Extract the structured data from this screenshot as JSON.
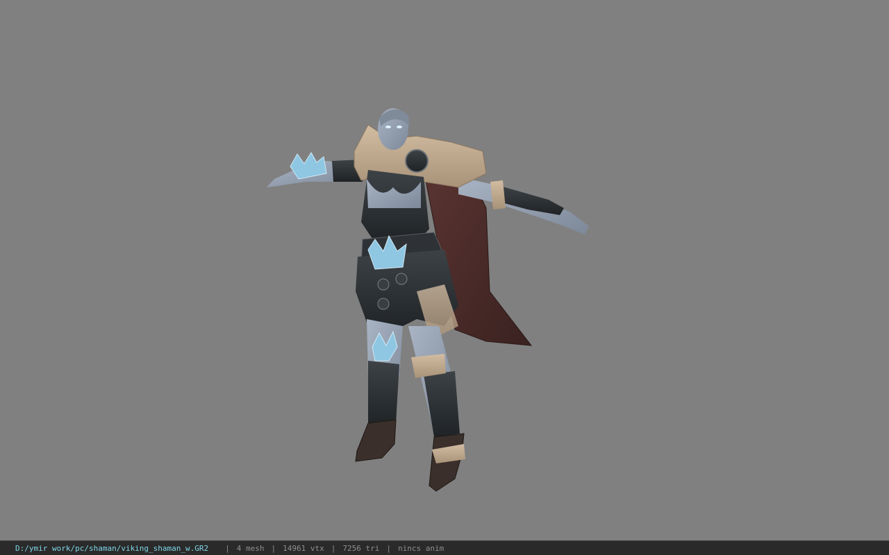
{
  "viewer": {
    "background_color": "#808080",
    "model_subject": "female viking shaman character model in T-pose"
  },
  "status": {
    "file_path": "D:/ymir work/pc/shaman/viking_shaman_w.GR2",
    "separator": "|",
    "mesh": "4 mesh",
    "vertices": "14961 vtx",
    "triangles": "7256 tri",
    "animation": "nincs anim"
  },
  "colors": {
    "statusbar_bg": "#2a2a2a",
    "path_text": "#7fd6e6",
    "info_text": "#8f8f8f"
  }
}
